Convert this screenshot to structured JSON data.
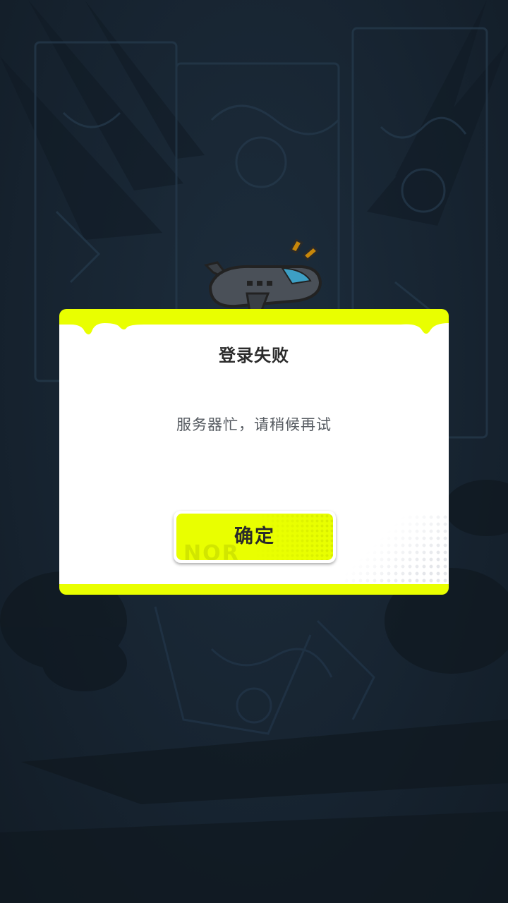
{
  "dialog": {
    "title": "登录失败",
    "message": "服务器忙，请稍候再试",
    "confirm_label": "确定"
  },
  "decor": {
    "button_watermark": "NOR"
  },
  "icons": {
    "mascot": "airplane-icon"
  },
  "colors": {
    "accent": "#e9ff00",
    "background": "#172431",
    "dialog_body": "#ffffff",
    "title_text": "#2b2b2b",
    "message_text": "#555a60"
  }
}
